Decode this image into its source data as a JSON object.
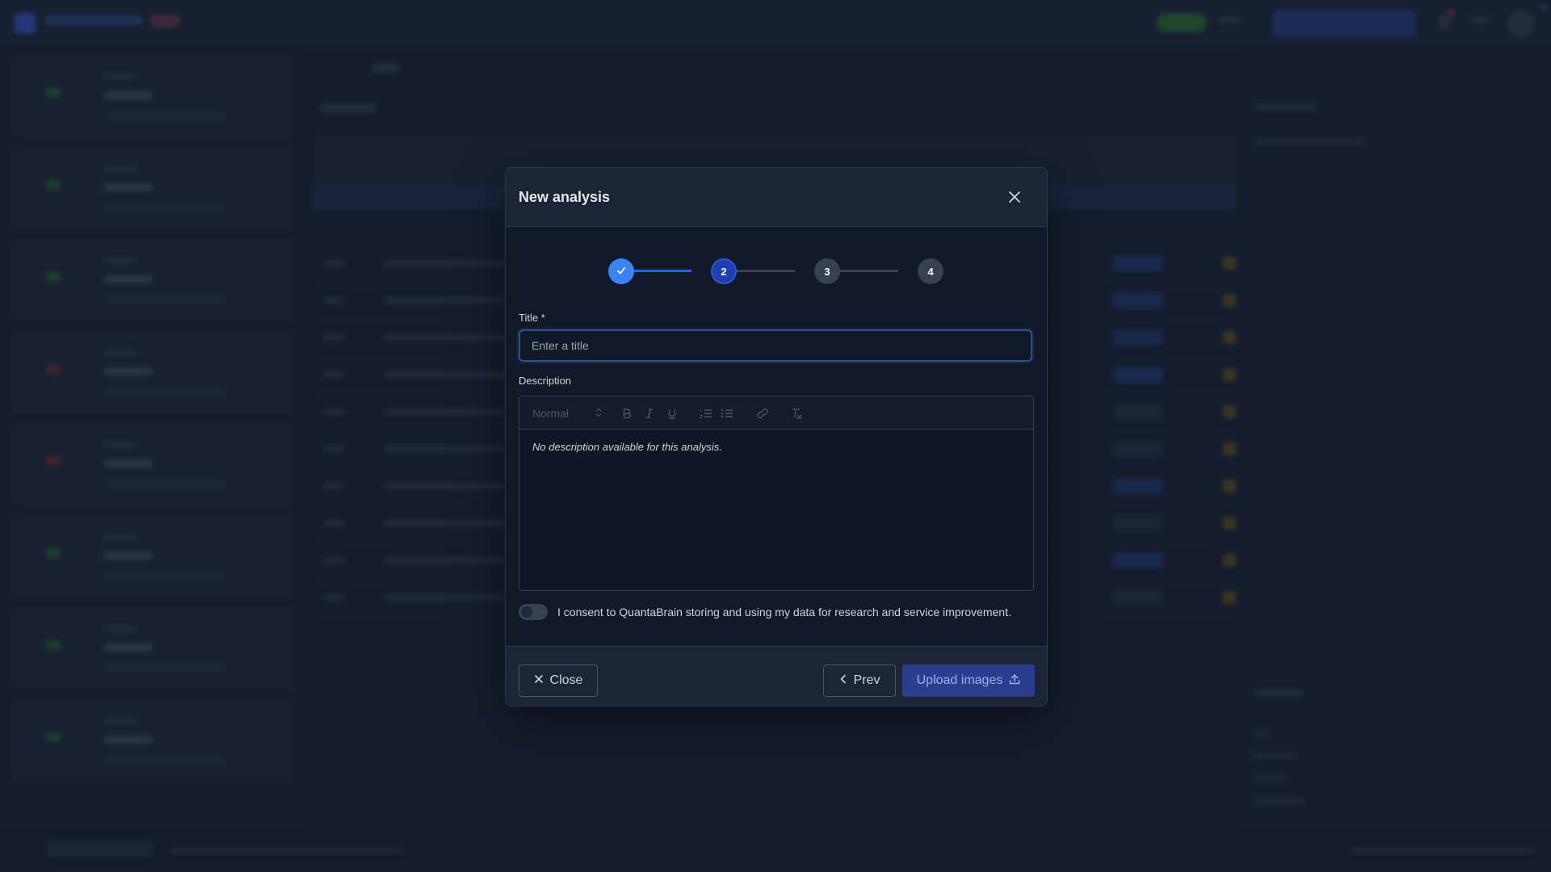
{
  "colors": {
    "modal_bg": "#111827",
    "header_bg": "#1c2536",
    "accent": "#3b82f6",
    "active_step": "#1e40af",
    "pending_step": "#374151",
    "primary_button": "#2b3d8f"
  },
  "modal": {
    "title": "New analysis",
    "close_icon": "close-icon",
    "stepper": {
      "steps": [
        {
          "label": "",
          "state": "completed",
          "icon": "check-icon"
        },
        {
          "label": "2",
          "state": "active"
        },
        {
          "label": "3",
          "state": "pending"
        },
        {
          "label": "4",
          "state": "pending"
        }
      ]
    },
    "title_field": {
      "label": "Title *",
      "value": "",
      "placeholder": "Enter a title"
    },
    "description": {
      "label": "Description",
      "format_select": "Normal",
      "toolbar_icons": [
        "bold-icon",
        "italic-icon",
        "underline-icon",
        "ordered-list-icon",
        "bullet-list-icon",
        "link-icon",
        "clear-format-icon"
      ],
      "content": "No description available for this analysis."
    },
    "consent": {
      "checked": false,
      "text": "I consent to QuantaBrain storing and using my data for research and service improvement."
    },
    "footer": {
      "close_label": "Close",
      "prev_label": "Prev",
      "upload_label": "Upload images"
    }
  }
}
